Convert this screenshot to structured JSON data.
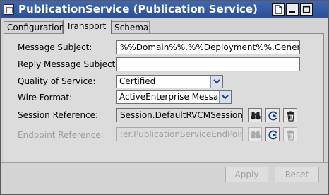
{
  "window": {
    "title": "PublicationService (Publication Service)"
  },
  "tabs": [
    {
      "label": "Configuration"
    },
    {
      "label": "Transport"
    },
    {
      "label": "Schema"
    }
  ],
  "form": {
    "message_subject": {
      "label": "Message Subject:",
      "value": "%%Domain%%.%%Deployment%%.Generic"
    },
    "reply_subject": {
      "label": "Reply Message Subject:",
      "value": ""
    },
    "qos": {
      "label": "Quality of Service:",
      "value": "Certified"
    },
    "wire_format": {
      "label": "Wire Format:",
      "value": "ActiveEnterprise Message"
    },
    "session_ref": {
      "label": "Session Reference:",
      "value": "Session.DefaultRVCMSession"
    },
    "endpoint_ref": {
      "label": "Endpoint Reference:",
      "value": ":er.PublicationServiceEndPoint"
    }
  },
  "buttons": {
    "apply": "Apply",
    "reset": "Reset"
  },
  "colors": {
    "titlebar": "#2f5aa3",
    "panel": "#dcdcdc",
    "disabled_text": "#9e9e9e"
  }
}
